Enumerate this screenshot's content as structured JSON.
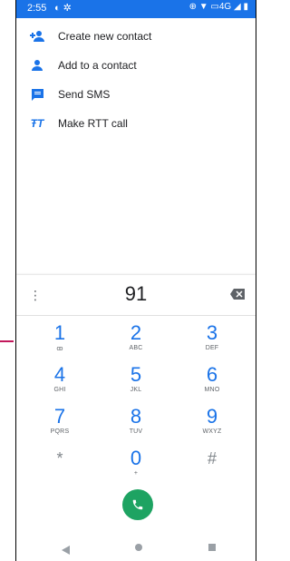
{
  "status_bar": {
    "time": "2:55",
    "left_icons": [
      "notification-icon",
      "settings-icon"
    ],
    "right_text": "4G",
    "right_icons": [
      "location-icon",
      "wifi-icon",
      "volte-icon",
      "signal-icon",
      "battery-icon"
    ]
  },
  "menu": {
    "items": [
      {
        "label": "Create new contact",
        "icon": "person-add-icon"
      },
      {
        "label": "Add to a contact",
        "icon": "person-icon"
      },
      {
        "label": "Send SMS",
        "icon": "message-icon"
      },
      {
        "label": "Make RTT call",
        "icon": "rtt-icon"
      }
    ]
  },
  "dialer": {
    "digits": "91",
    "overflow_icon": "⋮",
    "keys": [
      {
        "digit": "1",
        "letters": "ꝏ"
      },
      {
        "digit": "2",
        "letters": "ABC"
      },
      {
        "digit": "3",
        "letters": "DEF"
      },
      {
        "digit": "4",
        "letters": "GHI"
      },
      {
        "digit": "5",
        "letters": "JKL"
      },
      {
        "digit": "6",
        "letters": "MNO"
      },
      {
        "digit": "7",
        "letters": "PQRS"
      },
      {
        "digit": "8",
        "letters": "TUV"
      },
      {
        "digit": "9",
        "letters": "WXYZ"
      },
      {
        "digit": "*",
        "letters": ""
      },
      {
        "digit": "0",
        "letters": "+"
      },
      {
        "digit": "#",
        "letters": ""
      }
    ]
  },
  "colors": {
    "accent": "#1a73e8",
    "call_button": "#1ea362",
    "status_bar": "#1a73e8"
  }
}
